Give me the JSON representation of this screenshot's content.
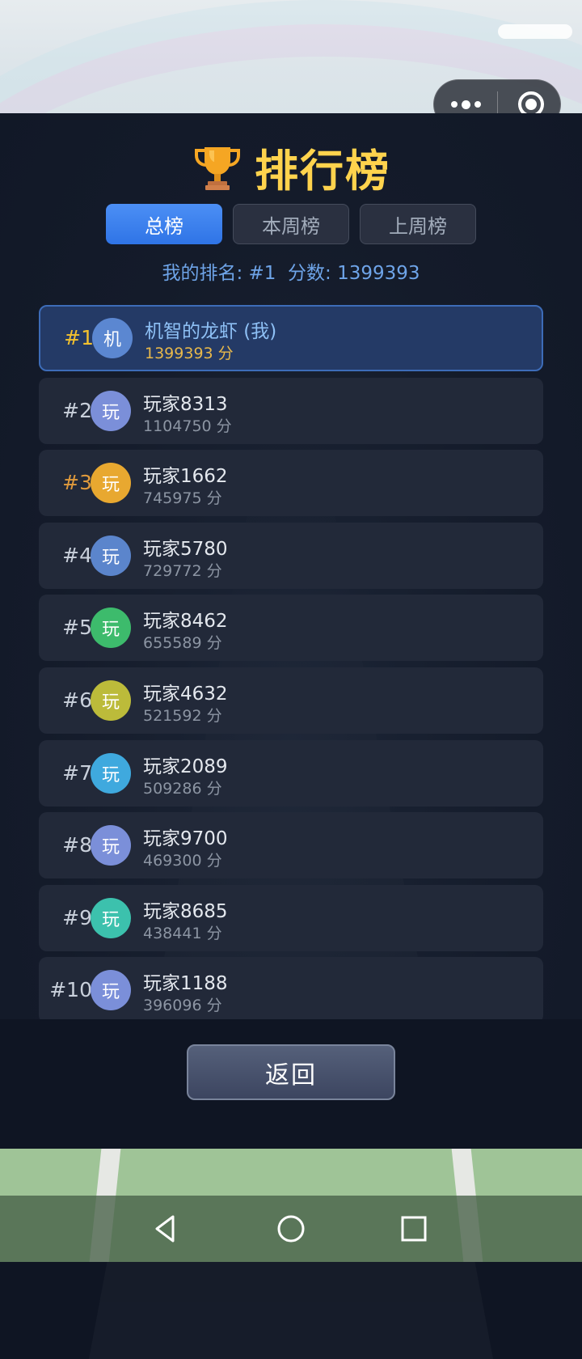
{
  "leaderboard": {
    "title": "排行榜",
    "tabs": [
      {
        "label": "总榜",
        "active": true
      },
      {
        "label": "本周榜",
        "active": false
      },
      {
        "label": "上周榜",
        "active": false
      }
    ],
    "my_rank_text": "我的排名: #1  分数: 1399393",
    "entries": [
      {
        "rank": "#1",
        "avatar": "机",
        "avatar_color": "#5b87d1",
        "name": "机智的龙虾 (我)",
        "score": "1399393 分",
        "is_me": true
      },
      {
        "rank": "#2",
        "avatar": "玩",
        "avatar_color": "#7b8fd9",
        "name": "玩家8313",
        "score": "1104750 分"
      },
      {
        "rank": "#3",
        "avatar": "玩",
        "avatar_color": "#e8a830",
        "name": "玩家1662",
        "score": "745975 分"
      },
      {
        "rank": "#4",
        "avatar": "玩",
        "avatar_color": "#5b85cc",
        "name": "玩家5780",
        "score": "729772 分"
      },
      {
        "rank": "#5",
        "avatar": "玩",
        "avatar_color": "#3dbb6c",
        "name": "玩家8462",
        "score": "655589 分"
      },
      {
        "rank": "#6",
        "avatar": "玩",
        "avatar_color": "#bcbb3a",
        "name": "玩家4632",
        "score": "521592 分"
      },
      {
        "rank": "#7",
        "avatar": "玩",
        "avatar_color": "#3fa9de",
        "name": "玩家2089",
        "score": "509286 分"
      },
      {
        "rank": "#8",
        "avatar": "玩",
        "avatar_color": "#7b8fd9",
        "name": "玩家9700",
        "score": "469300 分"
      },
      {
        "rank": "#9",
        "avatar": "玩",
        "avatar_color": "#3cc1ad",
        "name": "玩家8685",
        "score": "438441 分"
      },
      {
        "rank": "#10",
        "avatar": "玩",
        "avatar_color": "#7b8fd9",
        "name": "玩家1188",
        "score": "396096 分"
      }
    ],
    "back_label": "返回"
  },
  "system": {
    "capsule_icons": [
      "more-icon",
      "close-target-icon"
    ],
    "nav_icons": [
      "back-triangle-icon",
      "home-circle-icon",
      "recents-square-icon"
    ]
  },
  "colors": {
    "title_gold": "#ffd34d",
    "tab_active": "#3a82ee",
    "my_rank_text": "#6ea4e8",
    "rank_gold": "#f3c12e",
    "rank_bronze": "#e09a3c"
  }
}
